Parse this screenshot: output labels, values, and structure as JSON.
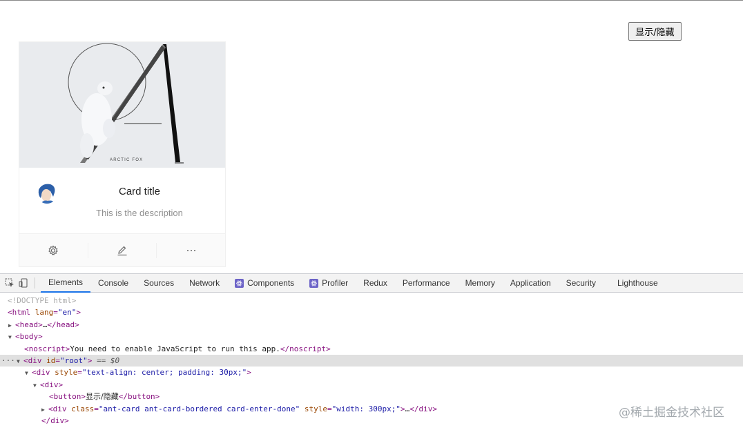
{
  "page": {
    "toggle_button": "显示/隐藏",
    "card": {
      "cover_caption": "ARCTIC FOX",
      "title": "Card title",
      "description": "This is the description",
      "actions": [
        "setting-icon",
        "edit-icon",
        "ellipsis-icon"
      ]
    }
  },
  "devtools": {
    "tabs": [
      "Elements",
      "Console",
      "Sources",
      "Network",
      "Components",
      "Profiler",
      "Redux",
      "Performance",
      "Memory",
      "Application",
      "Security",
      "Lighthouse"
    ],
    "active_tab": "Elements",
    "dom": {
      "doctype": "<!DOCTYPE html>",
      "html_tag": "html",
      "html_attr": "lang",
      "html_val": "\"en\"",
      "head": "head",
      "body": "body",
      "noscript_tag": "noscript",
      "noscript_text": "You need to enable JavaScript to run this app.",
      "root_attr": "id",
      "root_val": "\"root\"",
      "root_var": "== $0",
      "div_style": "style",
      "div_style_val": "\"text-align: center; padding: 30px;\"",
      "button_text": "显示/隐藏",
      "card_class": "class",
      "card_class_val": "\"ant-card ant-card-bordered card-enter-done\"",
      "card_style_val": "\"width: 300px;\""
    }
  },
  "watermark": "@稀土掘金技术社区"
}
